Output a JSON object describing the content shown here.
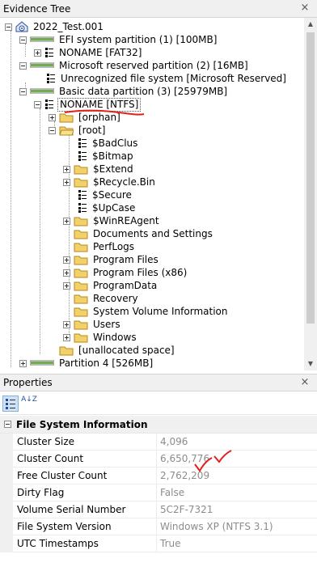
{
  "evidence_tree": {
    "title": "Evidence Tree",
    "items": [
      {
        "label": "2022_Test.001"
      },
      {
        "label": "EFI system partition (1) [100MB]"
      },
      {
        "label": "NONAME [FAT32]"
      },
      {
        "label": "Microsoft reserved partition (2) [16MB]"
      },
      {
        "label": "Unrecognized file system [Microsoft Reserved]"
      },
      {
        "label": "Basic data partition (3) [25979MB]"
      },
      {
        "label": "NONAME [NTFS]"
      },
      {
        "label": "[orphan]"
      },
      {
        "label": "[root]"
      },
      {
        "label": "$BadClus"
      },
      {
        "label": "$Bitmap"
      },
      {
        "label": "$Extend"
      },
      {
        "label": "$Recycle.Bin"
      },
      {
        "label": "$Secure"
      },
      {
        "label": "$UpCase"
      },
      {
        "label": "$WinREAgent"
      },
      {
        "label": "Documents and Settings"
      },
      {
        "label": "PerfLogs"
      },
      {
        "label": "Program Files"
      },
      {
        "label": "Program Files (x86)"
      },
      {
        "label": "ProgramData"
      },
      {
        "label": "Recovery"
      },
      {
        "label": "System Volume Information"
      },
      {
        "label": "Users"
      },
      {
        "label": "Windows"
      },
      {
        "label": "[unallocated space]"
      },
      {
        "label": "Partition 4 [526MB]"
      }
    ]
  },
  "properties": {
    "title": "Properties",
    "category": "File System Information",
    "rows": [
      {
        "name": "Cluster Size",
        "value": "4,096"
      },
      {
        "name": "Cluster Count",
        "value": "6,650,776"
      },
      {
        "name": "Free Cluster Count",
        "value": "2,762,209"
      },
      {
        "name": "Dirty Flag",
        "value": "False"
      },
      {
        "name": "Volume Serial Number",
        "value": "5C2F-7321"
      },
      {
        "name": "File System Version",
        "value": "Windows XP (NTFS 3.1)"
      },
      {
        "name": "UTC Timestamps",
        "value": "True"
      }
    ]
  },
  "close_glyph": "×",
  "sort_glyph": "A↓Z"
}
